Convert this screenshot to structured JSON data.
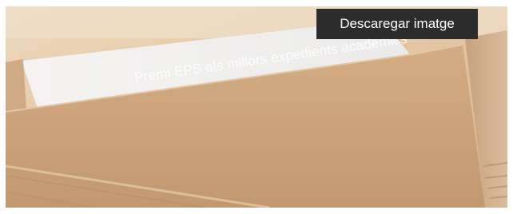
{
  "photo": {
    "caption": "Premi EPS als millors expedients acadèmics"
  },
  "actions": {
    "download_label": "Descaregar imatge"
  },
  "colors": {
    "button_bg": "#2c2c2c",
    "folder_tan": "#cfa57b",
    "background_tan": "#e6cba7",
    "paper_white": "#f2f0ee"
  }
}
